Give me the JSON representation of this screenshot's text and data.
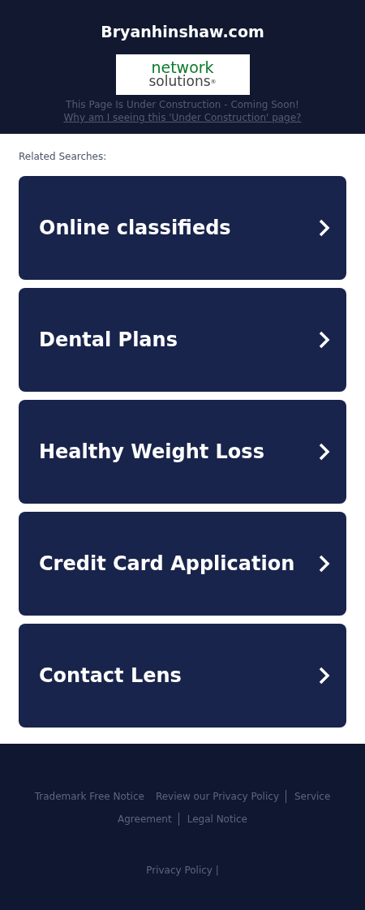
{
  "header": {
    "domain": "Bryanhinshaw.com",
    "logo": {
      "line_1": "network",
      "line_2": "solutions",
      "mark": "®"
    },
    "notice": "This Page Is Under Construction - Coming Soon!",
    "why_link": "Why am I seeing this 'Under Construction' page?"
  },
  "related": {
    "label": "Related Searches:",
    "items": [
      {
        "label": "Online classifieds"
      },
      {
        "label": "Dental Plans"
      },
      {
        "label": "Healthy Weight Loss"
      },
      {
        "label": "Credit Card Application"
      },
      {
        "label": "Contact Lens"
      }
    ]
  },
  "footer": {
    "links": [
      {
        "label": "Trademark Free Notice",
        "divider": false
      },
      {
        "label": "Review our Privacy Policy",
        "divider": false
      },
      {
        "label": "Service",
        "divider": true
      },
      {
        "label": "Agreement",
        "divider": false
      },
      {
        "label": "Legal Notice",
        "divider": true
      }
    ],
    "bottom_link": "Privacy Policy |"
  }
}
